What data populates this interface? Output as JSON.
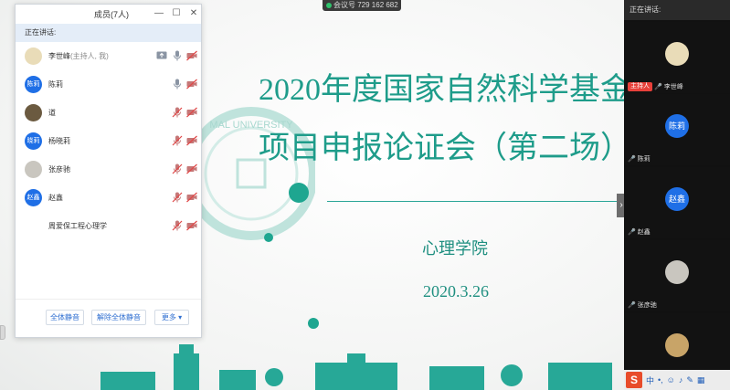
{
  "meeting": {
    "id_text": "会议号 729 162 682"
  },
  "slide": {
    "title_line1": "2020年度国家自然科学基金",
    "title_line2": "项目申报论证会（第二场）",
    "department": "心理学院",
    "date": "2020.3.26",
    "accent_color": "#1e9c8a"
  },
  "panel": {
    "title": "成员(7人)",
    "speaking_label": "正在讲话:",
    "participants": [
      {
        "name": "李世峰",
        "role": "(主持人, 我)",
        "avatar_color": "#e9dcb8",
        "avatar_text": ""
      },
      {
        "name": "陈莉",
        "role": "",
        "avatar_color": "#1f6fe6",
        "avatar_text": "陈莉"
      },
      {
        "name": "道",
        "role": "",
        "avatar_color": "#6b5a40",
        "avatar_text": ""
      },
      {
        "name": "杨晓莉",
        "role": "",
        "avatar_color": "#1f6fe6",
        "avatar_text": "晓莉"
      },
      {
        "name": "张彦驰",
        "role": "",
        "avatar_color": "#c9c6bf",
        "avatar_text": ""
      },
      {
        "name": "赵鑫",
        "role": "",
        "avatar_color": "#1f6fe6",
        "avatar_text": "赵鑫"
      },
      {
        "name": "周爱保工程心理学",
        "role": "",
        "avatar_color": "#ffffff",
        "avatar_text": ""
      }
    ],
    "footer": {
      "mute_all": "全体静音",
      "unmute_all": "解除全体静音",
      "more": "更多 ▾"
    }
  },
  "strip": {
    "top_label": "正在讲话:",
    "host_badge": "主持人",
    "tiles": [
      {
        "name": "李世峰",
        "avatar_color": "#e9dcb8",
        "avatar_text": ""
      },
      {
        "name": "陈莉",
        "avatar_color": "#1f6fe6",
        "avatar_text": "陈莉"
      },
      {
        "name": "赵鑫",
        "avatar_color": "#1f6fe6",
        "avatar_text": "赵鑫"
      },
      {
        "name": "张彦驰",
        "avatar_color": "#c9c6bf",
        "avatar_text": ""
      },
      {
        "name": "",
        "avatar_color": "#c8a468",
        "avatar_text": ""
      }
    ]
  },
  "ime": {
    "logo": "S",
    "mode": "中"
  }
}
